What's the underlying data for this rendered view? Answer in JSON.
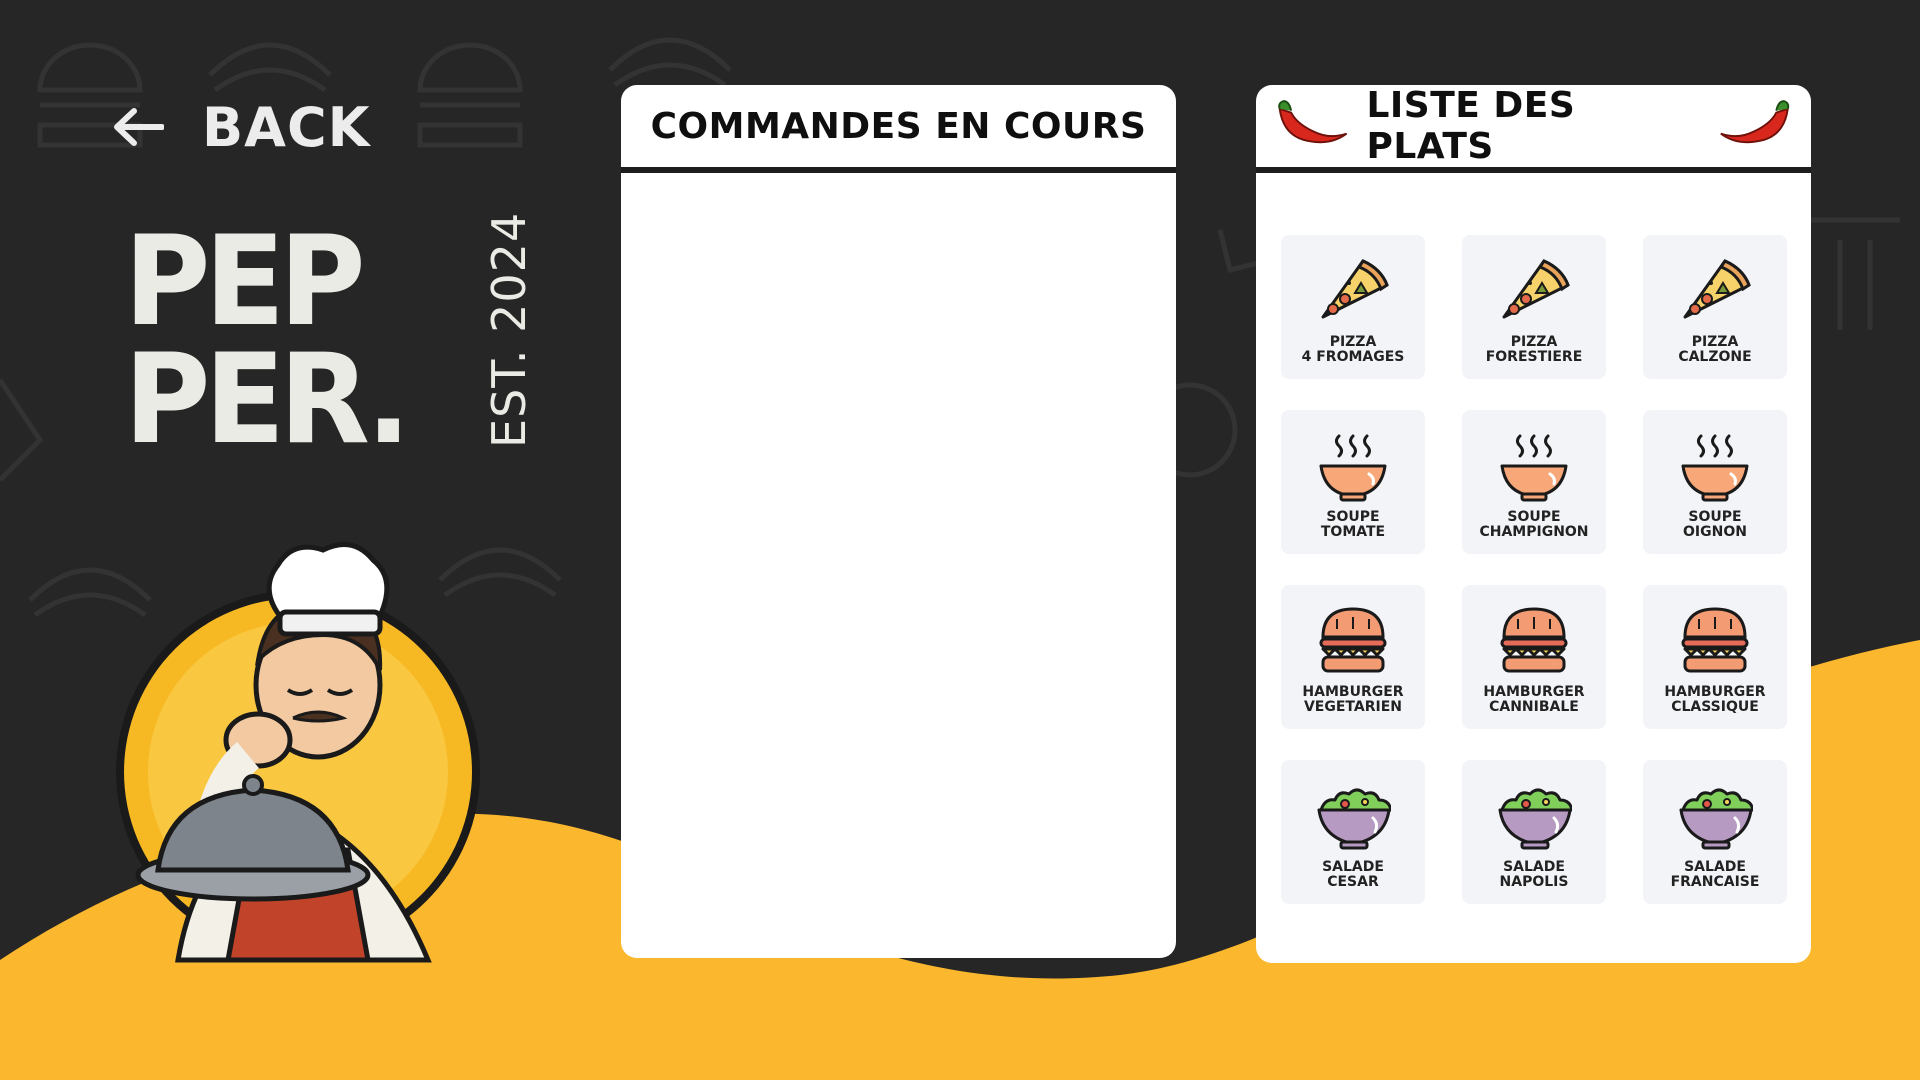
{
  "nav": {
    "back_label": "BACK",
    "back_icon": "arrow-left-icon"
  },
  "logo": {
    "line1": "PEP",
    "line2": "PER.",
    "est": "EST. 2024"
  },
  "colors": {
    "background": "#262626",
    "accent": "#fbb72d",
    "panel": "#ffffff"
  },
  "orders_panel": {
    "title": "COMMANDES EN COURS",
    "items": []
  },
  "dishes_panel": {
    "title": "LISTE DES PLATS",
    "dishes": [
      {
        "line1": "PIZZA",
        "line2": "4 FROMAGES",
        "icon": "pizza-icon"
      },
      {
        "line1": "PIZZA",
        "line2": "FORESTIERE",
        "icon": "pizza-icon"
      },
      {
        "line1": "PIZZA",
        "line2": "CALZONE",
        "icon": "pizza-icon"
      },
      {
        "line1": "SOUPE",
        "line2": "TOMATE",
        "icon": "soup-bowl-icon"
      },
      {
        "line1": "SOUPE",
        "line2": "CHAMPIGNON",
        "icon": "soup-bowl-icon"
      },
      {
        "line1": "SOUPE",
        "line2": "OIGNON",
        "icon": "soup-bowl-icon"
      },
      {
        "line1": "HAMBURGER",
        "line2": "VEGETARIEN",
        "icon": "hamburger-icon"
      },
      {
        "line1": "HAMBURGER",
        "line2": "CANNIBALE",
        "icon": "hamburger-icon"
      },
      {
        "line1": "HAMBURGER",
        "line2": "CLASSIQUE",
        "icon": "hamburger-icon"
      },
      {
        "line1": "SALADE",
        "line2": "CESAR",
        "icon": "salad-bowl-icon"
      },
      {
        "line1": "SALADE",
        "line2": "NAPOLIS",
        "icon": "salad-bowl-icon"
      },
      {
        "line1": "SALADE",
        "line2": "FRANCAISE",
        "icon": "salad-bowl-icon"
      }
    ]
  }
}
